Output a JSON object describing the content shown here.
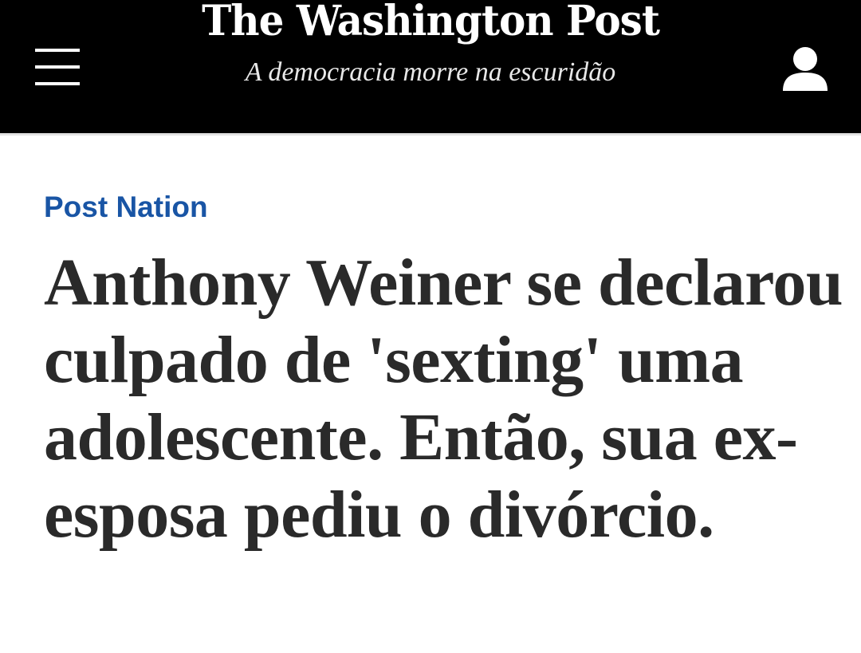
{
  "header": {
    "masthead": "The Washington Post",
    "tagline": "A democracia morre na escuridão",
    "menu_icon": "hamburger-menu-icon",
    "account_icon": "user-account-icon"
  },
  "article": {
    "section_label": "Post Nation",
    "headline": "Anthony Weiner se declarou culpado de 'sexting' uma adolescente. Então, sua ex-esposa pediu o divórcio."
  },
  "colors": {
    "header_background": "#000000",
    "section_label": "#1955a5",
    "headline_text": "#2a2a2a"
  }
}
